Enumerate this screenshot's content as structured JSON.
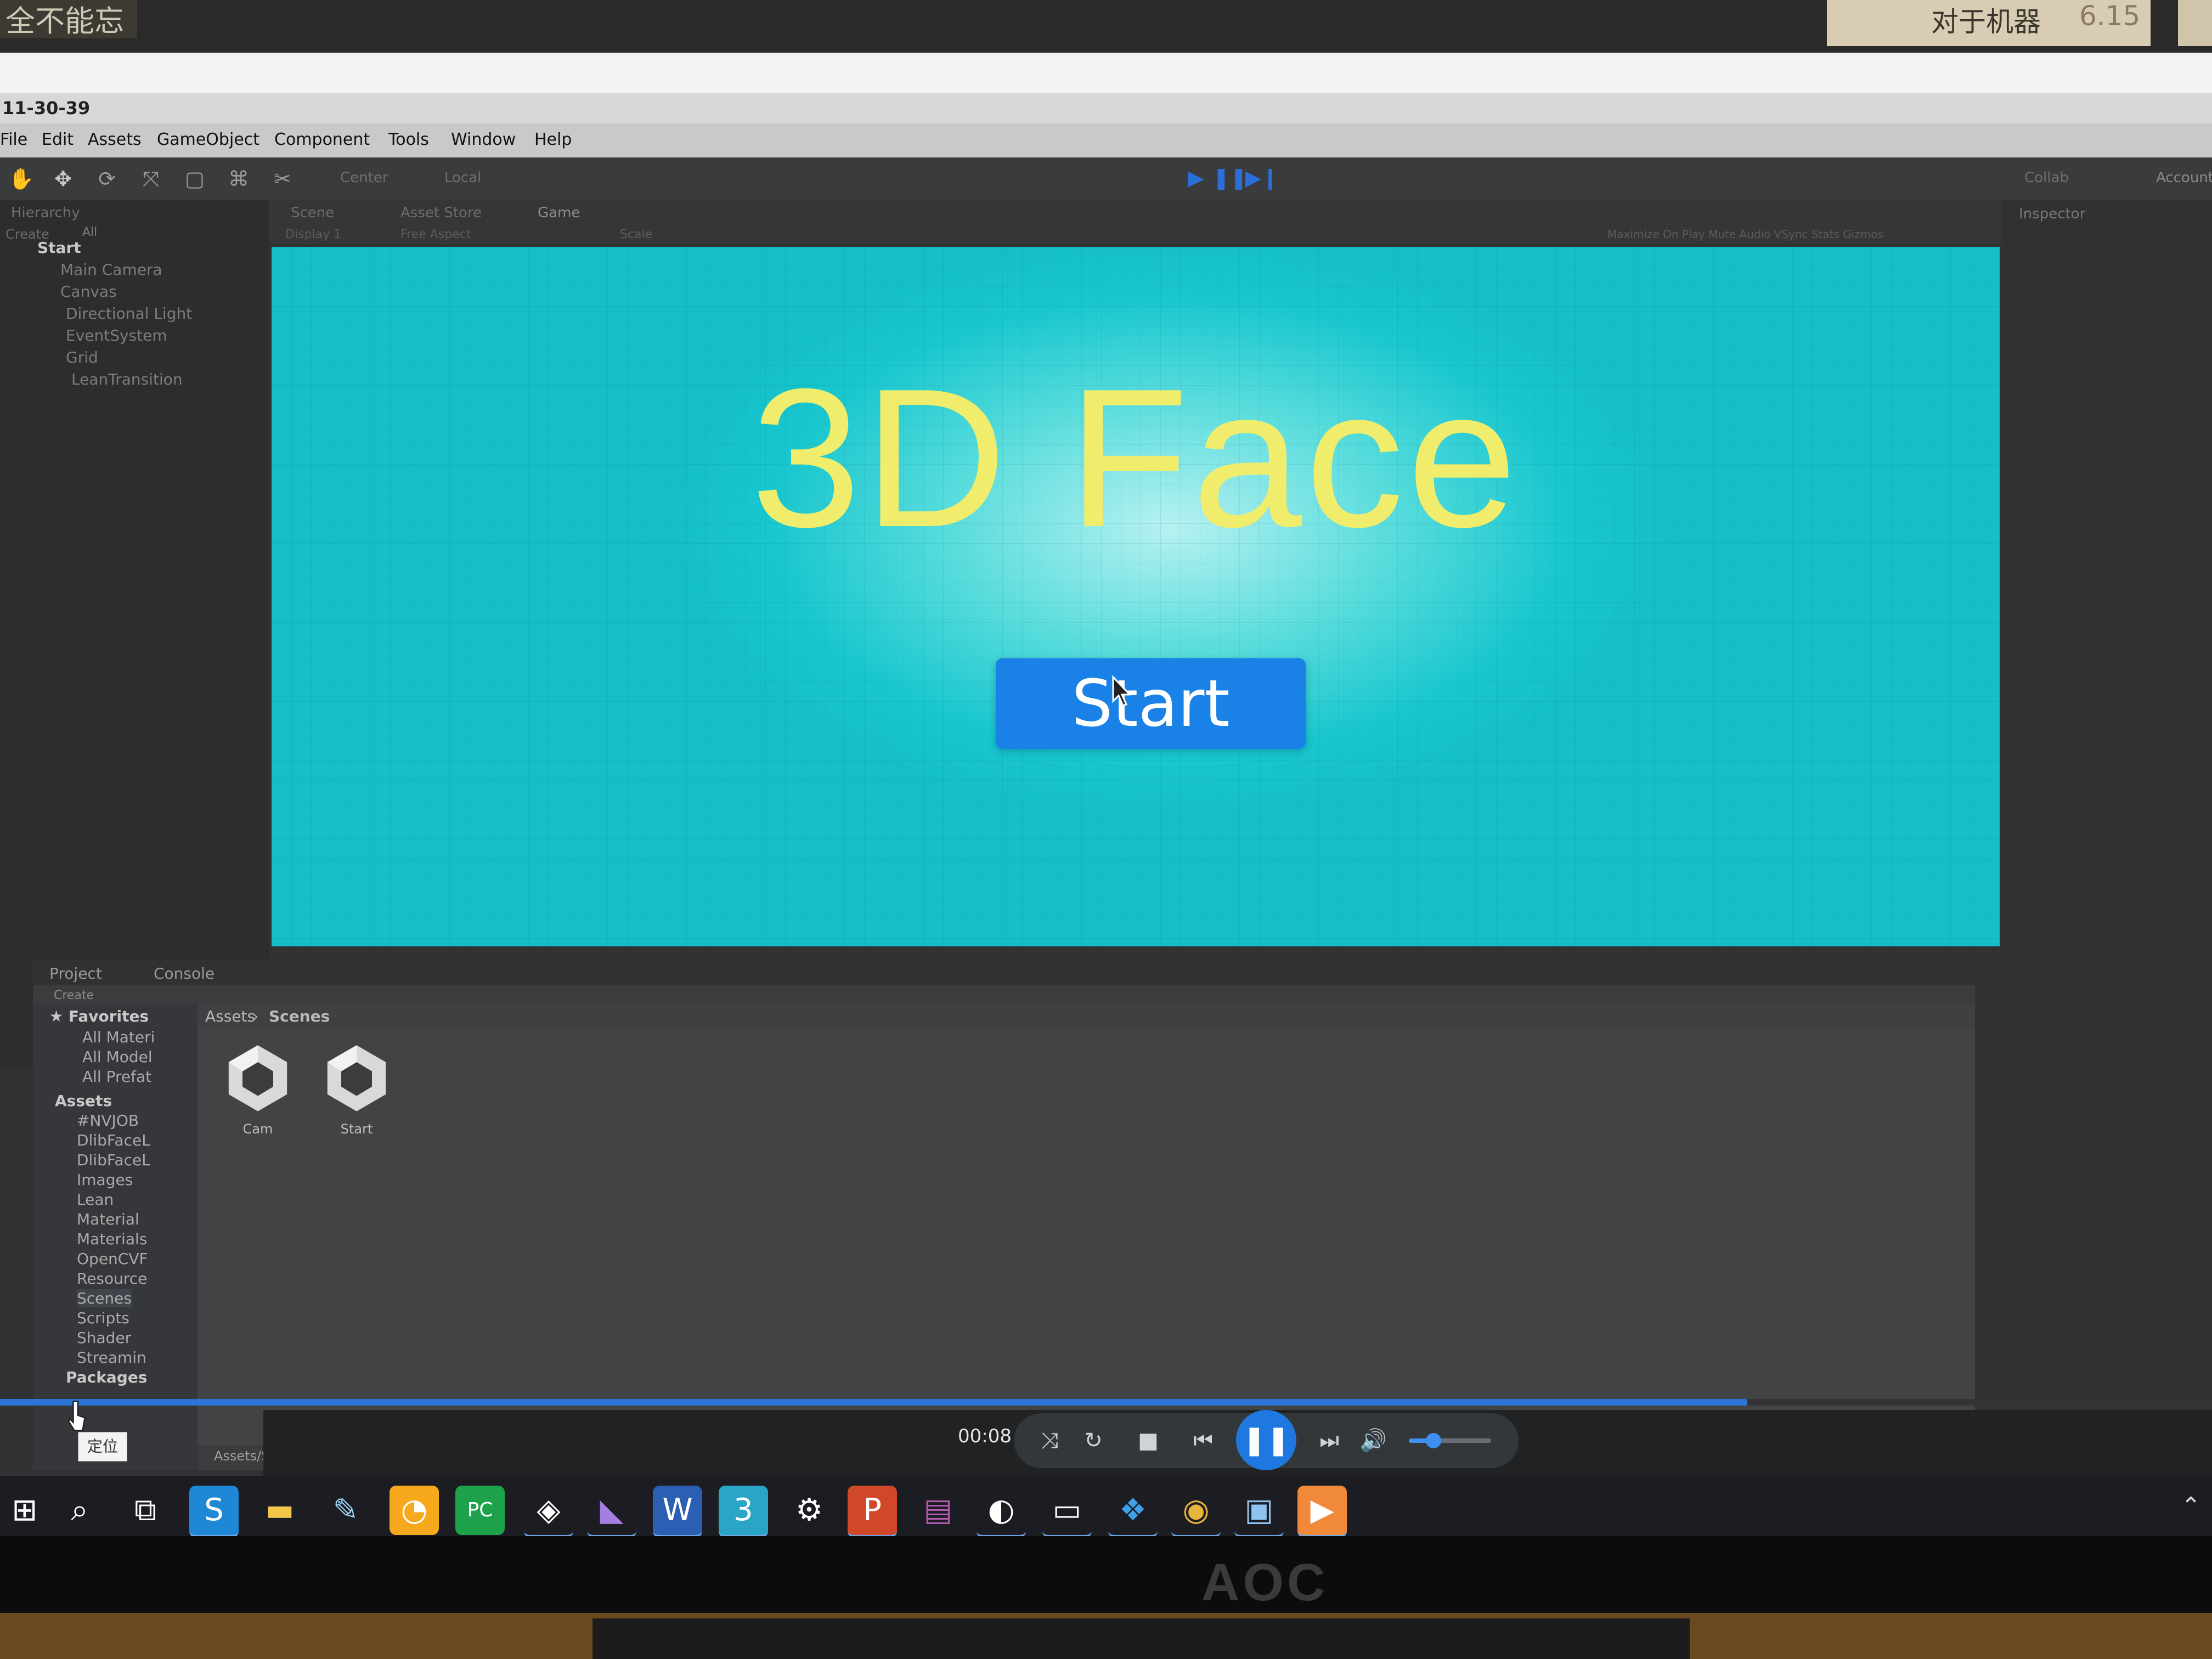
{
  "wall": {
    "note_left": "全不能忘",
    "note_right": "对于机器",
    "note_right_num": "6.15"
  },
  "monitor": {
    "brand": "AOC"
  },
  "window": {
    "title": "11-30-39"
  },
  "menu": [
    "File",
    "Edit",
    "Assets",
    "GameObject",
    "Component",
    "Tools",
    "Window",
    "Help"
  ],
  "toolbar": {
    "pivot": "Center",
    "space": "Local",
    "account": "Account",
    "collab": "Collab"
  },
  "hierarchy": {
    "tab": "Hierarchy",
    "create": "Create",
    "search": "All",
    "root": "Start",
    "items": [
      "Main Camera",
      "Canvas",
      "Directional Light",
      "EventSystem",
      "Grid",
      "LeanTransition"
    ]
  },
  "view_tabs": {
    "scene": "Scene",
    "asset_store": "Asset Store",
    "game": "Game",
    "display": "Display 1",
    "aspect": "Free Aspect",
    "scale": "Scale",
    "options": "Maximize On Play   Mute Audio   VSync   Stats   Gizmos"
  },
  "game": {
    "title": "3D Face",
    "start_button": "Start"
  },
  "inspector": {
    "tab": "Inspector"
  },
  "project": {
    "tab_project": "Project",
    "tab_console": "Console",
    "create": "Create",
    "favorites_label": "Favorites",
    "favorites": [
      "All Materi",
      "All Model",
      "All Prefat"
    ],
    "assets_label": "Assets",
    "folders": [
      "#NVJOB",
      "DlibFaceL",
      "DlibFaceL",
      "Images",
      "Lean",
      "Material",
      "Materials",
      "OpenCVF",
      "Resource",
      "Scenes",
      "Scripts",
      "Shader",
      "Streamin"
    ],
    "packages_label": "Packages",
    "breadcrumb_root": "Assets",
    "breadcrumb_current": "Scenes",
    "assets": [
      "Cam",
      "Start"
    ],
    "status_path": "Assets/Scripts/CameraTest.cs"
  },
  "player": {
    "time": "00:08",
    "tooltip": "定位",
    "progress": 0.79,
    "volume": 0.3
  },
  "taskbar": {
    "icons": [
      "windows-start",
      "search",
      "task-view",
      "skype",
      "file-explorer",
      "paint",
      "gallery",
      "pycharm",
      "unity",
      "visual-studio",
      "word",
      "3d-tool",
      "settings",
      "powerpoint",
      "winrar",
      "app",
      "terminal",
      "cube-app",
      "chrome",
      "remote-desktop",
      "video-player"
    ]
  },
  "colors": {
    "game_bg": "#14bfc9",
    "title_yellow": "#f1ed6c",
    "button_blue": "#1a82e6",
    "player_accent": "#1e78e0"
  }
}
